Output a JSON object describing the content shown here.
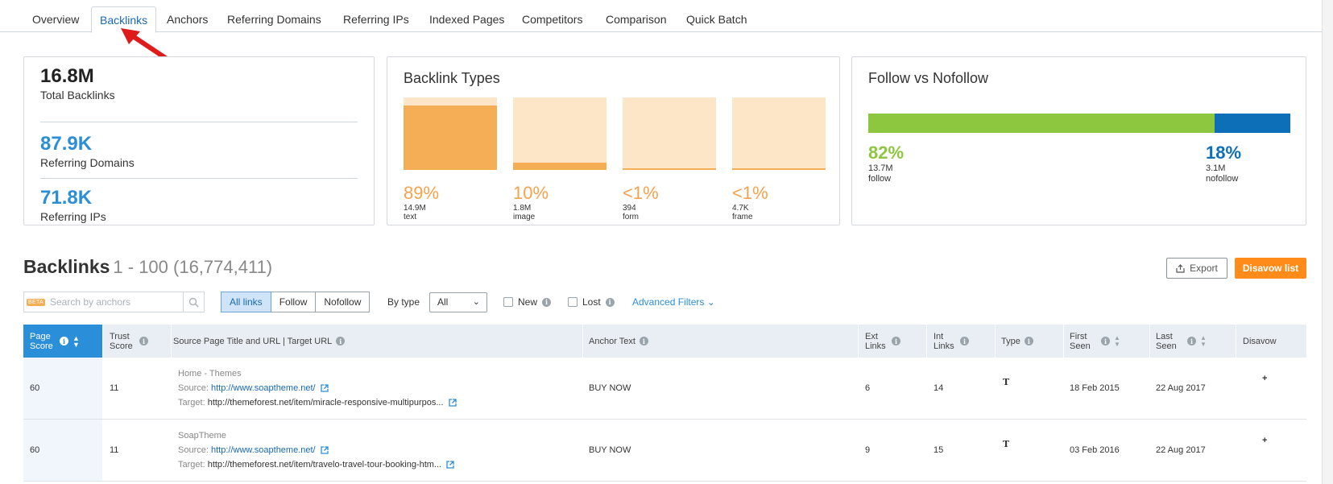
{
  "tabs": [
    {
      "label": "Overview",
      "active": false
    },
    {
      "label": "Backlinks",
      "active": true
    },
    {
      "label": "Anchors",
      "active": false
    },
    {
      "label": "Referring Domains",
      "active": false
    },
    {
      "label": "Referring IPs",
      "active": false
    },
    {
      "label": "Indexed Pages",
      "active": false
    },
    {
      "label": "Competitors",
      "active": false
    },
    {
      "label": "Comparison",
      "active": false
    },
    {
      "label": "Quick Batch",
      "active": false
    }
  ],
  "summary": {
    "total_backlinks": {
      "value": "16.8M",
      "label": "Total Backlinks"
    },
    "referring_domains": {
      "value": "87.9K",
      "label": "Referring Domains"
    },
    "referring_ips": {
      "value": "71.8K",
      "label": "Referring IPs"
    }
  },
  "backlink_types": {
    "title": "Backlink Types",
    "items": [
      {
        "pct": "89%",
        "count": "14.9M",
        "name": "text",
        "fill": 0.89
      },
      {
        "pct": "10%",
        "count": "1.8M",
        "name": "image",
        "fill": 0.1
      },
      {
        "pct": "<1%",
        "count": "394",
        "name": "form",
        "fill": 0.01
      },
      {
        "pct": "<1%",
        "count": "4.7K",
        "name": "frame",
        "fill": 0.01
      }
    ]
  },
  "follow_nofollow": {
    "title": "Follow vs Nofollow",
    "follow": {
      "pct": "82%",
      "count": "13.7M",
      "name": "follow",
      "fraction": 0.82
    },
    "nofollow": {
      "pct": "18%",
      "count": "3.1M",
      "name": "nofollow",
      "fraction": 0.18
    }
  },
  "section": {
    "title": "Backlinks",
    "range": "1 - 100 (16,774,411)",
    "export_label": "Export",
    "disavow_label": "Disavow list"
  },
  "filters": {
    "beta": "BETA",
    "search_placeholder": "Search by anchors",
    "link_types": [
      "All links",
      "Follow",
      "Nofollow"
    ],
    "by_type_label": "By type",
    "by_type_value": "All",
    "new_label": "New",
    "lost_label": "Lost",
    "advanced_label": "Advanced Filters"
  },
  "columns": {
    "page_score": "Page Score",
    "trust_score": "Trust Score",
    "source": "Source Page Title and URL | Target URL",
    "anchor": "Anchor Text",
    "ext_links": "Ext Links",
    "int_links": "Int Links",
    "type": "Type",
    "first_seen": "First Seen",
    "last_seen": "Last Seen",
    "disavow": "Disavow"
  },
  "rows": [
    {
      "page_score": "60",
      "trust_score": "11",
      "title": "Home - Themes",
      "source_label": "Source:",
      "source_url": "http://www.soaptheme.net/",
      "target_label": "Target:",
      "target_url": "http://themeforest.net/item/miracle-responsive-multipurpos...",
      "anchor": "BUY NOW",
      "ext": "6",
      "int": "14",
      "type": "T",
      "first_seen": "18 Feb 2015",
      "last_seen": "22 Aug 2017"
    },
    {
      "page_score": "60",
      "trust_score": "11",
      "title": "SoapTheme",
      "source_label": "Source:",
      "source_url": "http://www.soaptheme.net/",
      "target_label": "Target:",
      "target_url": "http://themeforest.net/item/travelo-travel-tour-booking-htm...",
      "anchor": "BUY NOW",
      "ext": "9",
      "int": "15",
      "type": "T",
      "first_seen": "03 Feb 2016",
      "last_seen": "22 Aug 2017"
    }
  ]
}
